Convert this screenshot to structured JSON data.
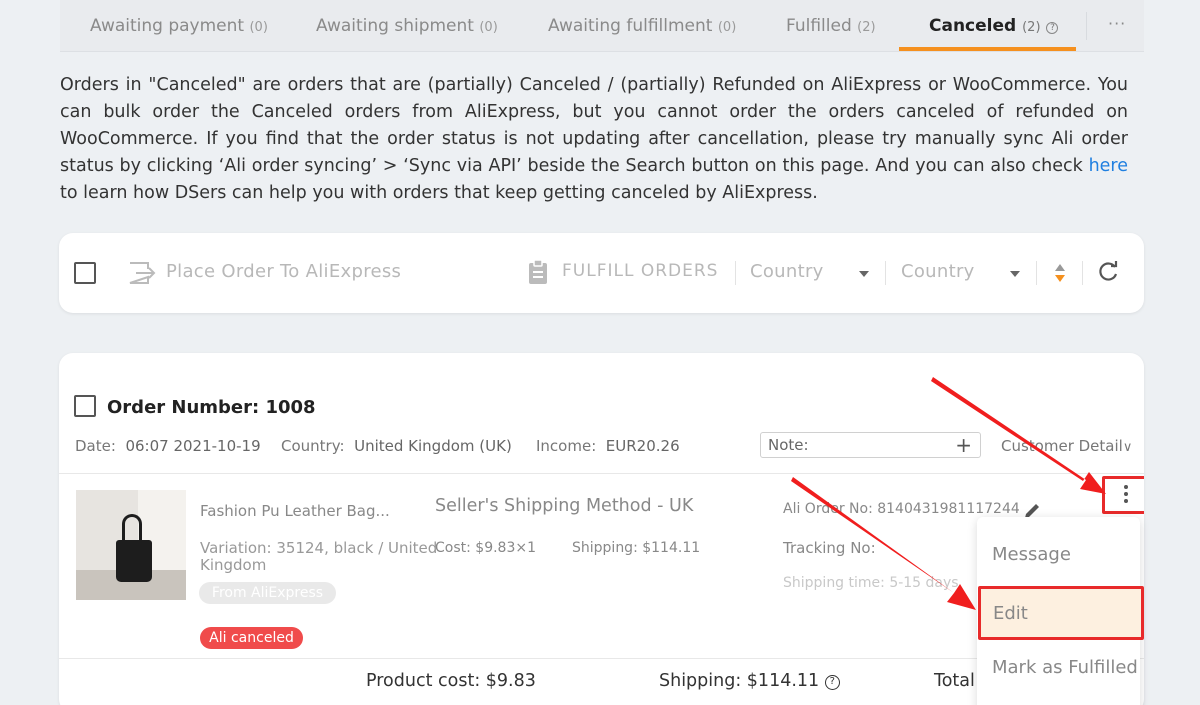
{
  "tabs": [
    {
      "label": "Awaiting payment",
      "count": "(0)"
    },
    {
      "label": "Awaiting shipment",
      "count": "(0)"
    },
    {
      "label": "Awaiting fulfillment",
      "count": "(0)"
    },
    {
      "label": "Fulfilled",
      "count": "(2)"
    },
    {
      "label": "Canceled",
      "count": "(2)"
    }
  ],
  "active_tab": "Canceled",
  "more_icon": "ellipsis-icon",
  "info": {
    "text_before_link": "Orders in \"Canceled\" are orders that are (partially) Canceled / (partially) Refunded on AliExpress or WooCommerce. You can bulk order the Canceled orders from AliExpress, but you cannot order the orders canceled of refunded on WooCommerce. If you find that the order status is not updating after cancellation, please try manually sync Ali order status by clicking ‘Ali order syncing’ > ‘Sync via API’ beside the Search button on this page. And you can also check ",
    "link_text": "here",
    "text_after_link": " to learn how DSers can help you with orders that keep getting canceled by AliExpress."
  },
  "toolbar": {
    "place_order_label": "Place Order To AliExpress",
    "fulfill_label": "FULFILL ORDERS",
    "country_filter_1": "Country",
    "country_filter_2": "Country"
  },
  "order": {
    "title": "Order Number: 1008",
    "date_label": "Date:",
    "date_value": "06:07 2021-10-19",
    "country_label": "Country:",
    "country_value": "United Kingdom (UK)",
    "income_label": "Income:",
    "income_value": "EUR20.26",
    "note_placeholder": "Note:",
    "customer_detail": "Customer Detail",
    "product_name": "Fashion Pu Leather Bag...",
    "variation_line1": "Variation: 35124, black / United",
    "variation_line2": "Kingdom",
    "source_badge": "From AliExpress",
    "status_badge": "Ali canceled",
    "shipping_method": "Seller's Shipping Method - UK",
    "cost": "Cost: $9.83×1",
    "shipping": "Shipping: $114.11",
    "ali_order_no": "Ali Order No: 8140431981117244",
    "tracking_no": "Tracking No:",
    "shipping_time": "Shipping time: 5-15 days",
    "product_cost_total": "Product cost: $9.83",
    "shipping_total": "Shipping: $114.11",
    "total_label": "Total"
  },
  "menu": {
    "items": [
      "Message",
      "Edit",
      "Mark as Fulfilled"
    ],
    "highlighted": "Edit"
  },
  "colors": {
    "accent": "#f5901e",
    "highlight_red": "#e82a2a",
    "link": "#1f7fe0",
    "badge_red": "#f04b4b"
  }
}
